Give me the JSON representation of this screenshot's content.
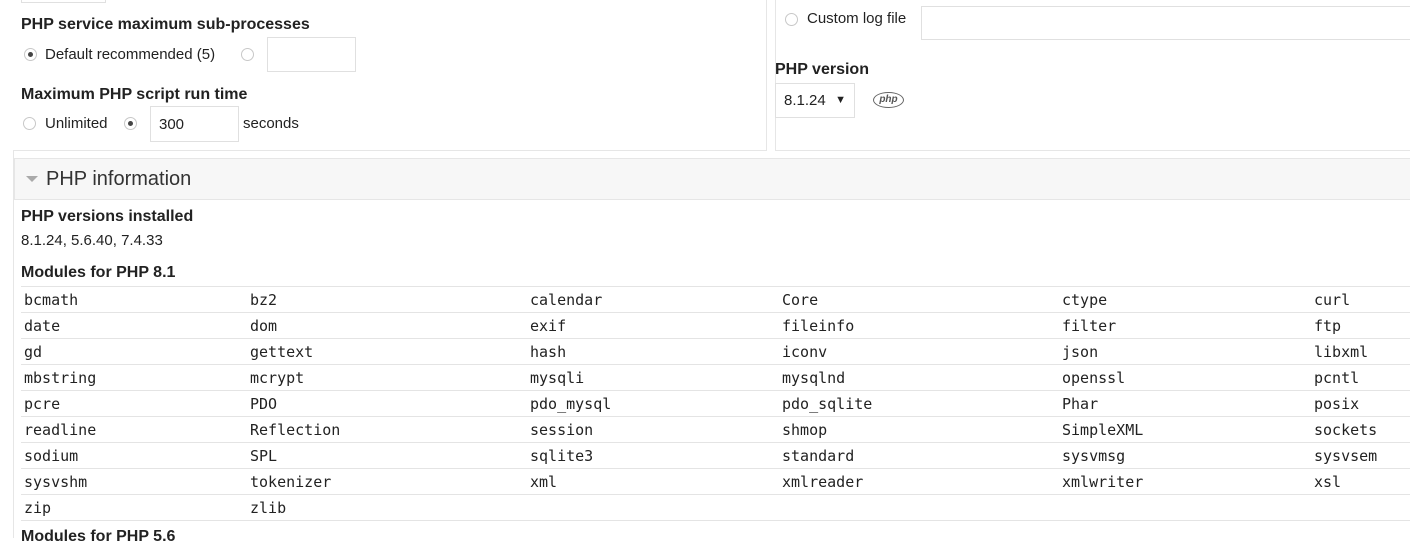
{
  "left_settings": {
    "subprocesses": {
      "label": "PHP service maximum sub-processes",
      "default_option": "Default recommended (5)",
      "custom_value": ""
    },
    "runtime": {
      "label": "Maximum PHP script run time",
      "unlimited_option": "Unlimited",
      "value": "300",
      "unit": "seconds"
    }
  },
  "right_settings": {
    "custom_log_label": "Custom log file",
    "custom_log_value": "",
    "php_version_label": "PHP version",
    "php_version_selected": "8.1.24",
    "php_logo_text": "php"
  },
  "php_information": {
    "section_title": "PHP information",
    "installed_label": "PHP versions installed",
    "installed_value": "8.1.24, 5.6.40, 7.4.33",
    "modules_81_label": "Modules for PHP 8.1",
    "modules_81": [
      [
        "bcmath",
        "bz2",
        "calendar",
        "Core",
        "ctype",
        "curl"
      ],
      [
        "date",
        "dom",
        "exif",
        "fileinfo",
        "filter",
        "ftp"
      ],
      [
        "gd",
        "gettext",
        "hash",
        "iconv",
        "json",
        "libxml"
      ],
      [
        "mbstring",
        "mcrypt",
        "mysqli",
        "mysqlnd",
        "openssl",
        "pcntl"
      ],
      [
        "pcre",
        "PDO",
        "pdo_mysql",
        "pdo_sqlite",
        "Phar",
        "posix"
      ],
      [
        "readline",
        "Reflection",
        "session",
        "shmop",
        "SimpleXML",
        "sockets"
      ],
      [
        "sodium",
        "SPL",
        "sqlite3",
        "standard",
        "sysvmsg",
        "sysvsem"
      ],
      [
        "sysvshm",
        "tokenizer",
        "xml",
        "xmlreader",
        "xmlwriter",
        "xsl"
      ],
      [
        "zip",
        "zlib",
        "",
        "",
        "",
        ""
      ]
    ],
    "modules_56_label": "Modules for PHP 5.6"
  },
  "colors": {
    "border": "#e6e6e6",
    "section_header_bg": "#f7f7f7",
    "text": "#222222"
  }
}
